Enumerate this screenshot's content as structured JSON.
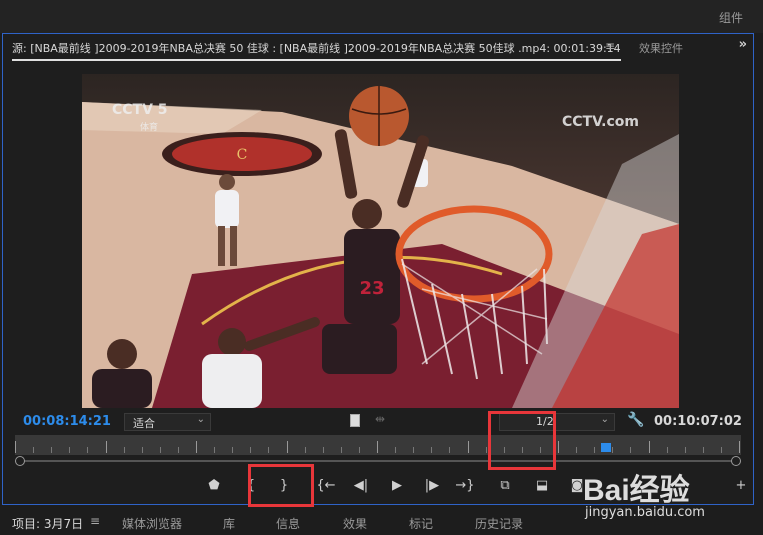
{
  "workspace": {
    "tab_label": "组件"
  },
  "source_panel": {
    "tab_title": "源: [NBA最前线 ]2009-2019年NBA总决赛 50 佳球 : [NBA最前线 ]2009-2019年NBA总决赛 50佳球 .mp4: 00:01:39:14",
    "tab_menu_icon": "≡",
    "effect_controls_label": "效果控件",
    "overflow_icon": "»"
  },
  "video": {
    "channel_logo_left": "CCTV 5",
    "channel_sub_left": "体育",
    "channel_logo_right": "CCTV.com",
    "jersey_number": "23"
  },
  "playback": {
    "current_timecode": "00:08:14:21",
    "fit_value": "适合",
    "resolution_value": "1/2",
    "duration_timecode": "00:10:07:02",
    "playhead_fraction": 0.814
  },
  "controls": [
    {
      "name": "add-marker-button",
      "glyph": "⬟"
    },
    {
      "name": "mark-in-button",
      "glyph": "{"
    },
    {
      "name": "mark-out-button",
      "glyph": "}"
    },
    {
      "name": "go-to-in-button",
      "glyph": "{←"
    },
    {
      "name": "step-back-button",
      "glyph": "◀|"
    },
    {
      "name": "play-button",
      "glyph": "▶"
    },
    {
      "name": "step-forward-button",
      "glyph": "|▶"
    },
    {
      "name": "go-to-out-button",
      "glyph": "→}"
    },
    {
      "name": "insert-button",
      "glyph": "⧉"
    },
    {
      "name": "overwrite-button",
      "glyph": "⬓"
    },
    {
      "name": "export-frame-button",
      "glyph": "◙"
    },
    {
      "name": "add-button",
      "glyph": "+"
    }
  ],
  "bottom_tabs": [
    {
      "label": "项目: 3月7日",
      "active": true
    },
    {
      "label": "媒体浏览器",
      "active": false
    },
    {
      "label": "库",
      "active": false
    },
    {
      "label": "信息",
      "active": false
    },
    {
      "label": "效果",
      "active": false
    },
    {
      "label": "标记",
      "active": false
    },
    {
      "label": "历史记录",
      "active": false
    }
  ],
  "bottom_tab_menu_icon": "≡",
  "watermark": {
    "brand": "Bai经验",
    "url": "jingyan.baidu.com"
  },
  "colors": {
    "accent": "#2d8ceb",
    "highlight": "#e8363a",
    "panel_border": "#2f63c8"
  }
}
